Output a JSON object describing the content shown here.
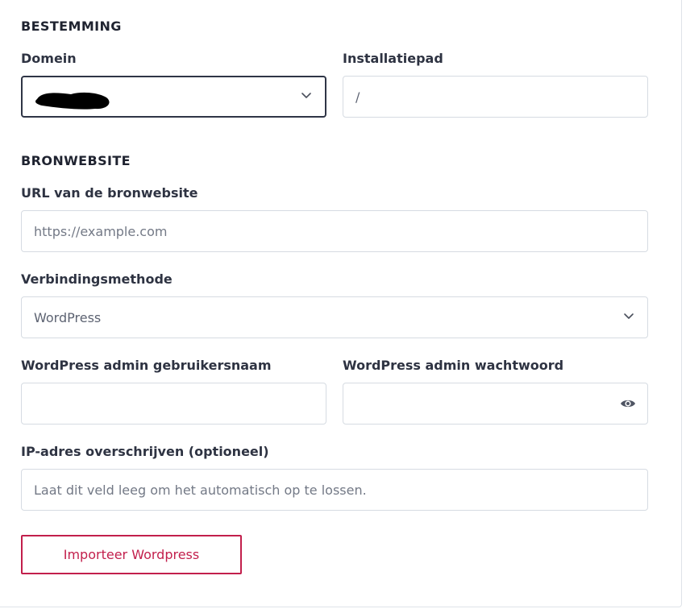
{
  "destination": {
    "title": "BESTEMMING",
    "domain_label": "Domein",
    "domain_value": "",
    "install_path_label": "Installatiepad",
    "install_path_value": "/"
  },
  "source": {
    "title": "BRONWEBSITE",
    "url_label": "URL van de bronwebsite",
    "url_placeholder": "https://example.com",
    "method_label": "Verbindingsmethode",
    "method_value": "WordPress",
    "admin_user_label": "WordPress admin gebruikersnaam",
    "admin_user_value": "",
    "admin_password_label": "WordPress admin wachtwoord",
    "admin_password_value": "",
    "ip_label": "IP-adres overschrijven (optioneel)",
    "ip_placeholder": "Laat dit veld leeg om het automatisch op te lossen."
  },
  "actions": {
    "import_label": "Importeer Wordpress"
  },
  "icons": {
    "domain_dropdown": "chevron-down-icon",
    "method_dropdown": "chevron-down-icon",
    "password_toggle": "eye-icon"
  },
  "colors": {
    "accent": "#c21f4c",
    "border": "#d6dbe2",
    "focus_border": "#2f3546"
  }
}
